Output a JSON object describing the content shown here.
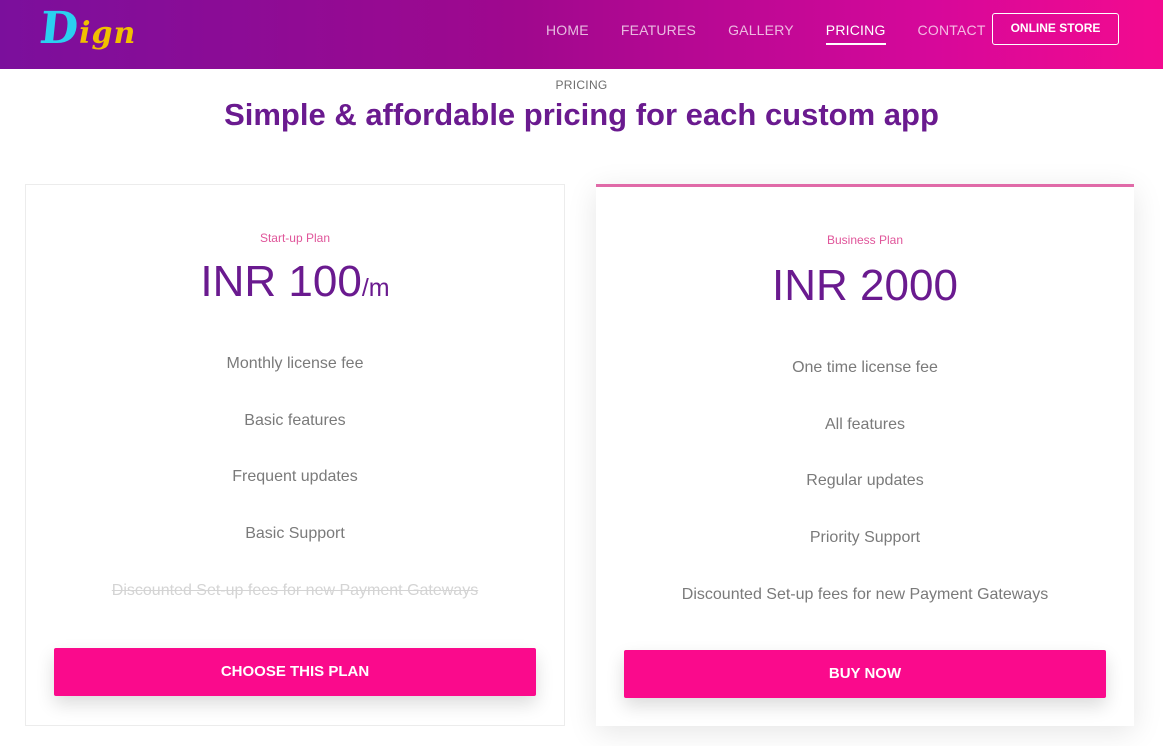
{
  "brand": {
    "logo_text_1": "D",
    "logo_text_2": "ign"
  },
  "nav": {
    "items": [
      {
        "label": "HOME"
      },
      {
        "label": "FEATURES"
      },
      {
        "label": "GALLERY"
      },
      {
        "label": "PRICING",
        "active": true
      },
      {
        "label": "CONTACT"
      }
    ],
    "store_button": "ONLINE STORE"
  },
  "section": {
    "eyebrow": "PRICING",
    "headline": "Simple & affordable pricing for each custom app"
  },
  "plans": [
    {
      "label": "Start-up Plan",
      "price": "INR 100",
      "unit": "/m",
      "features": [
        "Monthly license fee",
        "Basic features",
        "Frequent updates",
        "Basic Support",
        "Discounted Set-up fees for new Payment Gateways"
      ],
      "struck_features": [
        4
      ],
      "cta": "CHOOSE THIS PLAN"
    },
    {
      "label": "Business Plan",
      "price": "INR 2000",
      "unit": "",
      "features": [
        "One time license fee",
        "All features",
        "Regular updates",
        "Priority Support",
        "Discounted Set-up fees for new Payment Gateways"
      ],
      "struck_features": [],
      "cta": "BUY NOW"
    }
  ],
  "colors": {
    "accent": "#fa0a8c",
    "headline": "#6a1a8f",
    "plan_label": "#e0559a"
  }
}
